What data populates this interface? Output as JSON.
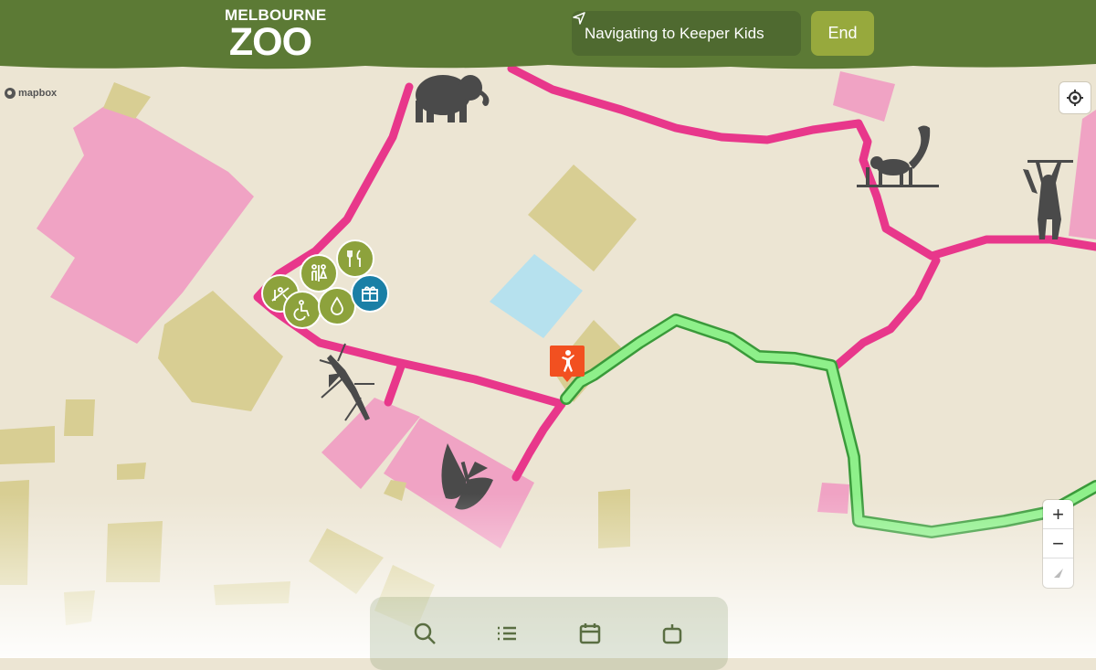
{
  "header": {
    "logo_line1": "MELBOURNE",
    "logo_line2": "ZOO",
    "navigation_text": "Navigating to Keeper Kids",
    "end_label": "End",
    "bar_color": "#5c7a35"
  },
  "map": {
    "attribution": "mapbox",
    "route_color": "#8de88a",
    "path_color": "#e8378b",
    "zoom_controls": [
      "+",
      "−",
      "compass"
    ]
  },
  "pois": [
    {
      "name": "playground-icon"
    },
    {
      "name": "toilets-icon"
    },
    {
      "name": "food-icon"
    },
    {
      "name": "accessible-icon"
    },
    {
      "name": "water-icon"
    },
    {
      "name": "gift-shop-icon"
    }
  ],
  "animals": [
    "elephant-icon",
    "monkey-icon",
    "gibbon-icon",
    "stick-insect-icon",
    "butterfly-icon"
  ],
  "bottom_nav": [
    "search-icon",
    "list-icon",
    "calendar-icon",
    "robot-icon"
  ]
}
